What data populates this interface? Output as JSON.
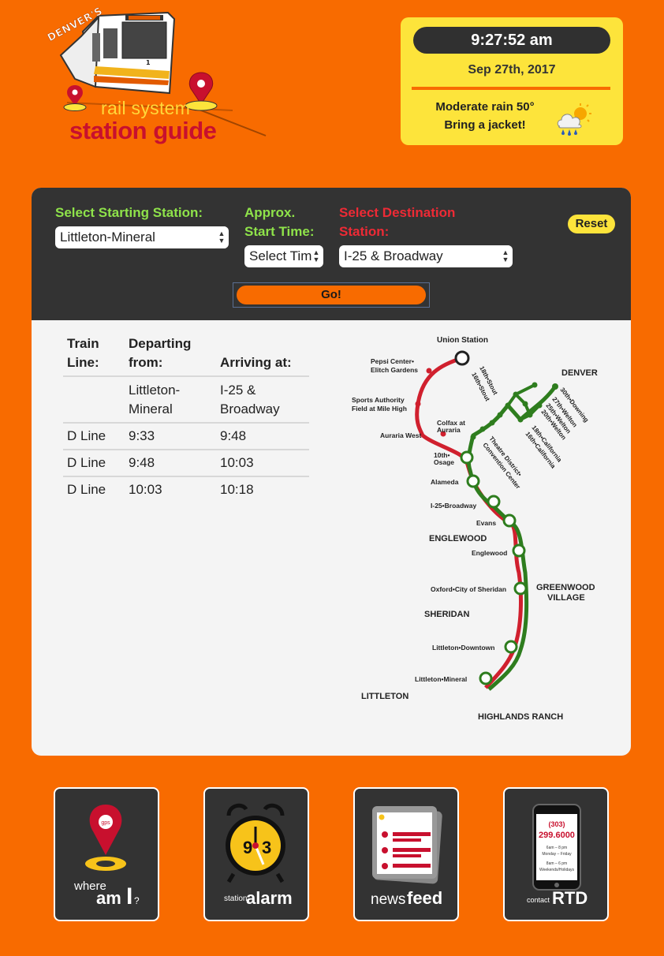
{
  "logo": {
    "tag": "DENVER'S",
    "line1": "rail system",
    "line2": "station guide",
    "train_number": "1"
  },
  "clock": {
    "time": "9:27:52 am",
    "date": "Sep 27th, 2017",
    "weather_line1": "Moderate rain 50°",
    "weather_line2": "Bring a jacket!",
    "weather_icon": "rain-cloud-sun-icon"
  },
  "trip": {
    "start_label_1": "Select Starting Station:",
    "start_value": "Littleton-Mineral",
    "time_label_1": "Approx.",
    "time_label_2": "Start Time:",
    "time_value": "Select Time",
    "dest_label_1": "Select Destination",
    "dest_label_2": "Station:",
    "dest_value": "I-25 & Broadway",
    "reset_label": "Reset",
    "go_label": "Go!"
  },
  "schedule": {
    "headers": {
      "line_1": "Train",
      "line_2": "Line:",
      "dep_1": "Departing",
      "dep_2": "from:",
      "arr_1": "Arriving at:"
    },
    "stations": {
      "from_1": "Littleton-",
      "from_2": "Mineral",
      "to_1": "I-25 &",
      "to_2": "Broadway"
    },
    "rows": [
      {
        "line": "D Line",
        "depart": "9:33",
        "arrive": "9:48"
      },
      {
        "line": "D Line",
        "depart": "9:48",
        "arrive": "10:03"
      },
      {
        "line": "D Line",
        "depart": "10:03",
        "arrive": "10:18"
      }
    ]
  },
  "map": {
    "line_colors": {
      "red": "#d0202e",
      "green": "#2e7d1e"
    },
    "labels": {
      "union_station": "Union Station",
      "pepsi_1": "Pepsi Center•",
      "pepsi_2": "Elitch Gardens",
      "sports_1": "Sports Authority",
      "sports_2": "Field at Mile High",
      "auraria_west": "Auraria West",
      "colfax_1": "Colfax at",
      "colfax_2": "Auraria",
      "tenth_1": "10th•",
      "tenth_2": "Osage",
      "alameda": "Alameda",
      "i25": "I-25•Broadway",
      "evans": "Evans",
      "englewood_area": "ENGLEWOOD",
      "englewood": "Englewood",
      "oxford": "Oxford•City of Sheridan",
      "greenwood_1": "GREENWOOD",
      "greenwood_2": "VILLAGE",
      "sheridan": "SHERIDAN",
      "littleton_downtown": "Littleton•Downtown",
      "littleton_mineral": "Littleton•Mineral",
      "littleton": "LITTLETON",
      "highlands": "HIGHLANDS RANCH",
      "denver": "DENVER",
      "stout_18": "18th•Stout",
      "stout_16": "16th•Stout",
      "theatre_1": "Theatre District•",
      "theatre_2": "Convention Center",
      "downing": "30th•Downing",
      "welton_27": "27th•Welton",
      "welton_25": "25th•Welton",
      "welton_20": "20th•Welton",
      "california_18": "18th•California",
      "california_16": "16th•California"
    }
  },
  "footer": {
    "where_1": "where",
    "where_2": "am",
    "where_3": "I",
    "where_4": "?",
    "gps": "gps",
    "alarm_1": "station",
    "alarm_2": "alarm",
    "news_1": "news",
    "news_2": "feed",
    "contact_1": "contact",
    "contact_2": "RTD",
    "phone_area": "(303)",
    "phone_number": "299.6000",
    "hours_1": "6am – 8 pm",
    "hours_2": "Monday – Friday",
    "hours_3": "8am – 6 pm",
    "hours_4": "Weekends/Holidays"
  }
}
